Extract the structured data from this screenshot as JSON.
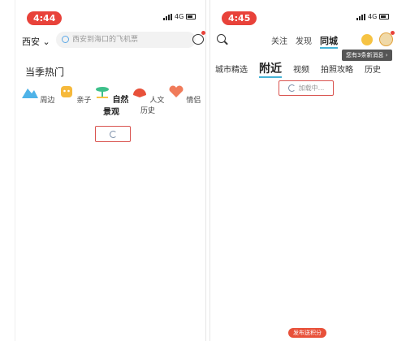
{
  "left": {
    "time": "4:44",
    "network": "4G",
    "city": "西安",
    "search_placeholder": "西安到海口的飞机票",
    "section_title": "当季热门",
    "categories": [
      {
        "label": "周边",
        "icon": "mountain-icon",
        "color": "#4fb3e8"
      },
      {
        "label": "亲子",
        "icon": "kid-face-icon",
        "color": "#f6b93b"
      },
      {
        "label": "自然景观",
        "icon": "palm-tree-icon",
        "color": "#3cc08a"
      },
      {
        "label": "人文历史",
        "icon": "fan-icon",
        "color": "#e8513a"
      },
      {
        "label": "情侣",
        "icon": "heart-icon",
        "color": "#f07b5a"
      }
    ]
  },
  "right": {
    "time": "4:45",
    "network": "4G",
    "top_tabs": [
      "关注",
      "发现",
      "同城"
    ],
    "notice": "您有3条新消息",
    "sub_tabs": [
      "城市精选",
      "附近",
      "视频",
      "拍照攻略",
      "历史"
    ],
    "loading_text": "加载中...",
    "fab_label": "发布送积分"
  },
  "colors": {
    "accent": "#e8423a",
    "tab_underline": "#46b3d6",
    "highlight_box": "#d9534f"
  }
}
